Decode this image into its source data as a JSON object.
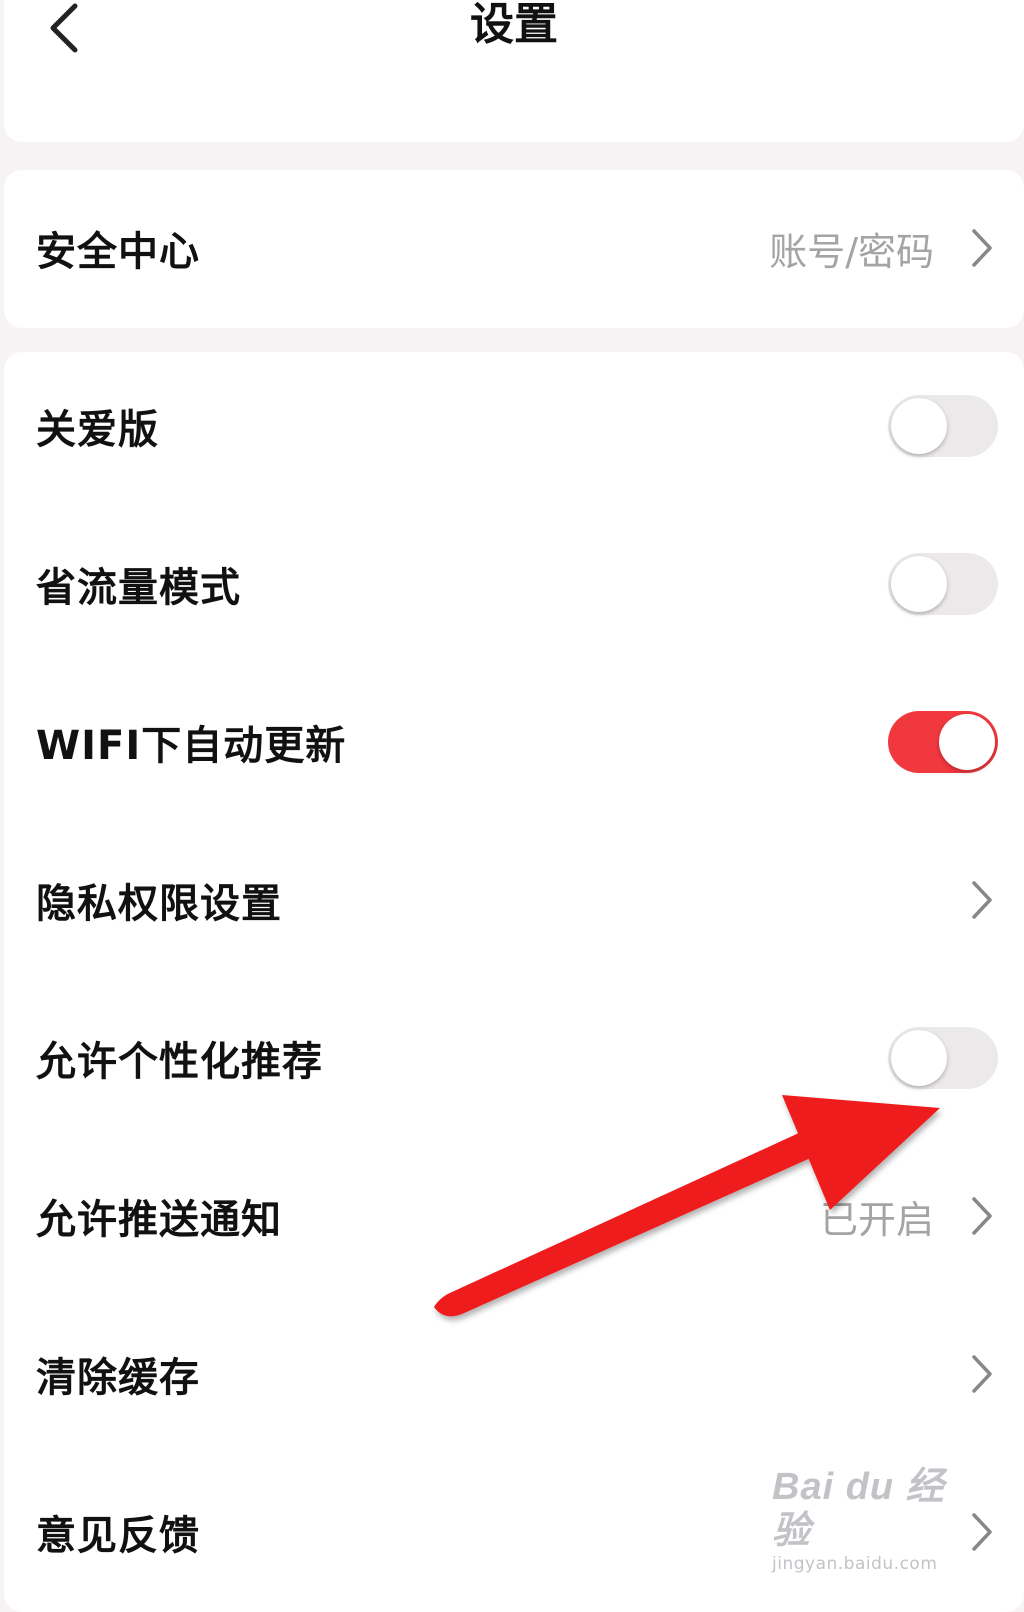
{
  "header": {
    "title": "设置"
  },
  "security": {
    "label": "安全中心",
    "value": "账号/密码"
  },
  "settings": {
    "care_mode": {
      "label": "关爱版",
      "on": false
    },
    "data_saver": {
      "label": "省流量模式",
      "on": false
    },
    "wifi_auto_update": {
      "label": "WIFI下自动更新",
      "on": true
    },
    "privacy_permissions": {
      "label": "隐私权限设置"
    },
    "personalized_recommend": {
      "label": "允许个性化推荐",
      "on": false
    },
    "push_notifications": {
      "label": "允许推送通知",
      "value": "已开启"
    },
    "clear_cache": {
      "label": "清除缓存"
    },
    "feedback": {
      "label": "意见反馈"
    }
  },
  "annotation": {
    "arrow_color": "#ee1c1c"
  },
  "watermark": {
    "logo": "Bai du 经验",
    "url": "jingyan.baidu.com"
  },
  "colors": {
    "accent": "#f0383e",
    "background": "#f7f3f5",
    "muted_text": "#a4a4a4"
  }
}
